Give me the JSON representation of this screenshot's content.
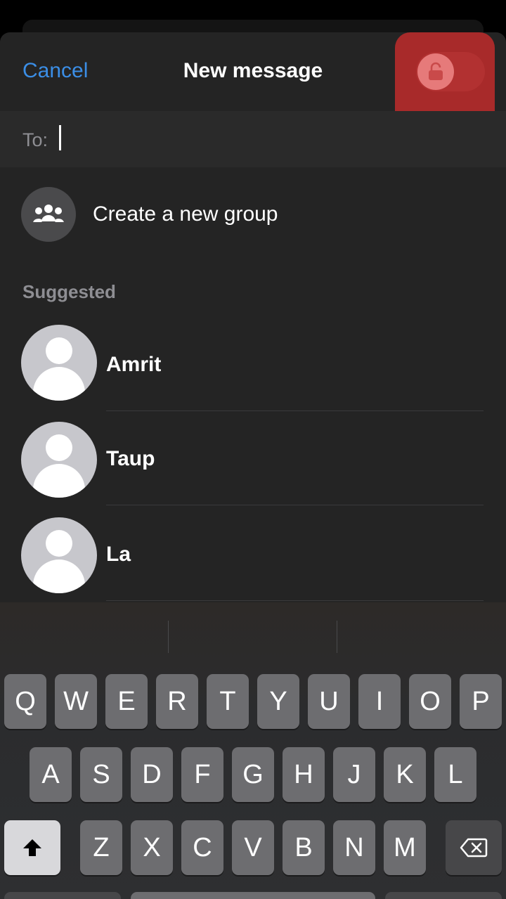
{
  "nav": {
    "cancel_label": "Cancel",
    "title": "New message"
  },
  "lock": {
    "icon": "lock-open-icon",
    "state": "off"
  },
  "to_field": {
    "label": "To:",
    "value": "",
    "placeholder": ""
  },
  "create_group": {
    "label": "Create a new group",
    "icon": "group-icon"
  },
  "suggested": {
    "header": "Suggested",
    "contacts": [
      {
        "name": "Amrit"
      },
      {
        "name": "Taup"
      },
      {
        "name": "La"
      }
    ]
  },
  "keyboard": {
    "row1": [
      "Q",
      "W",
      "E",
      "R",
      "T",
      "Y",
      "U",
      "I",
      "O",
      "P"
    ],
    "row2": [
      "A",
      "S",
      "D",
      "F",
      "G",
      "H",
      "J",
      "K",
      "L"
    ],
    "row3": [
      "Z",
      "X",
      "C",
      "V",
      "B",
      "N",
      "M"
    ],
    "shift_icon": "shift-icon",
    "backspace_icon": "backspace-icon"
  },
  "colors": {
    "accent": "#3b8ee6",
    "highlight": "#a82a2a",
    "background": "#242424"
  }
}
